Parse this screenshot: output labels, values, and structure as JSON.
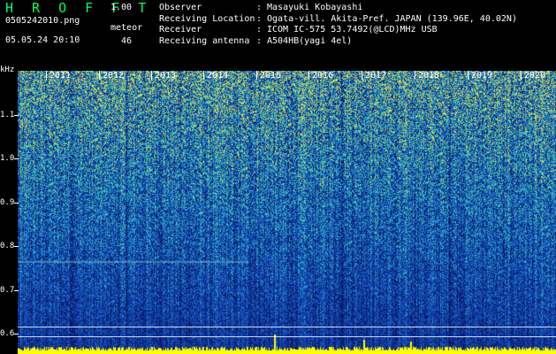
{
  "header": {
    "title": "H R O F F T",
    "version": "1.00",
    "filename": "0505242010.png",
    "datetime": "05.05.24 20:10",
    "meteor_label": "meteor",
    "meteor_count": "46"
  },
  "station_info": [
    {
      "key": "Observer",
      "value": "Masayuki Kobayashi"
    },
    {
      "key": "Receiving Location",
      "value": "Ogata-vill. Akita-Pref. JAPAN (139.96E, 40.02N)"
    },
    {
      "key": "Receiver",
      "value": "ICOM IC-575 53.7492(@LCD)MHz USB"
    },
    {
      "key": "Receiving antenna",
      "value": "A504HB(yagi 4el)"
    }
  ],
  "separator": ":",
  "y_axis": {
    "unit": "kHz",
    "labels": [
      "1.1",
      "1.0",
      "0.9",
      "0.8",
      "0.7",
      "0.6"
    ]
  },
  "x_axis": {
    "labels": [
      "2011",
      "2012",
      "2013",
      "2014",
      "2015",
      "2016",
      "2017",
      "2018",
      "2019",
      "2020"
    ]
  },
  "colors": {
    "title": "#00ff66",
    "signal_low": "#0a1e6a",
    "signal_mid": "#1d6fc0",
    "signal_high": "#3fd2b8",
    "peak": "#ffff00"
  }
}
